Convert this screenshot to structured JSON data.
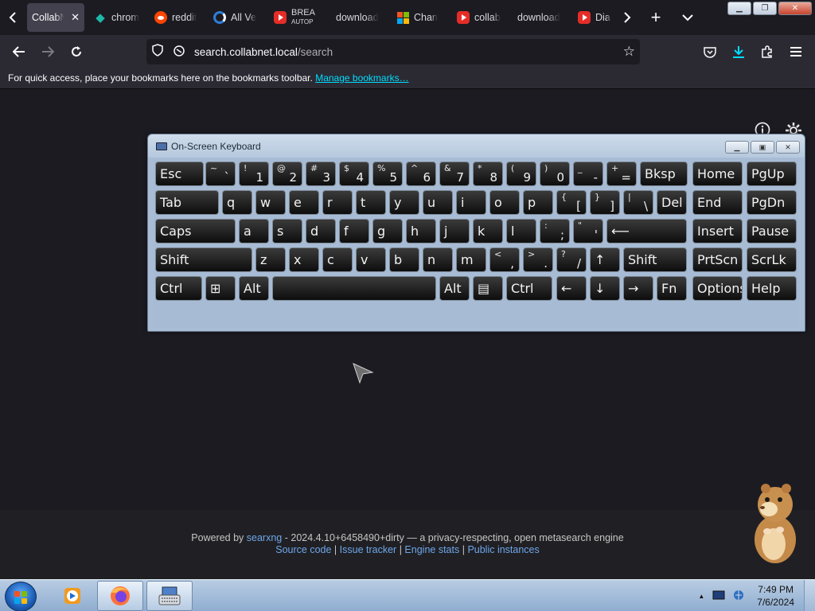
{
  "browser": {
    "tabs": [
      {
        "title": "CollabN",
        "icon": "",
        "active": true
      },
      {
        "title": "chrom",
        "icon": "chromatic-icon"
      },
      {
        "title": "reddit",
        "icon": "reddit-icon"
      },
      {
        "title": "All Ve",
        "icon": "edge-icon"
      },
      {
        "title": "BREA",
        "subtitle": "AUTOP",
        "icon": "youtube-icon"
      },
      {
        "title": "download",
        "icon": ""
      },
      {
        "title": "Chan",
        "icon": "microsoft-icon"
      },
      {
        "title": "collab",
        "icon": "youtube-icon"
      },
      {
        "title": "download",
        "icon": ""
      },
      {
        "title": "Diam",
        "icon": "youtube-icon"
      }
    ],
    "url_host": "search.collabnet.local",
    "url_path": "/search",
    "bookmarks_text": "For quick access, place your bookmarks here on the bookmarks toolbar.",
    "bookmarks_link": "Manage bookmarks…"
  },
  "footer": {
    "powered_by": "Powered by",
    "searxng": "searxng",
    "version_text": "- 2024.4.10+6458490+dirty — a privacy-respecting, open metasearch engine",
    "links": [
      "Source code",
      "Issue tracker",
      "Engine stats",
      "Public instances"
    ],
    "sep": "|"
  },
  "osk": {
    "title": "On-Screen Keyboard",
    "rows": [
      [
        {
          "m": "Esc"
        },
        {
          "s": "~",
          "l": "`"
        },
        {
          "s": "!",
          "l": "1"
        },
        {
          "s": "@",
          "l": "2"
        },
        {
          "s": "#",
          "l": "3"
        },
        {
          "s": "$",
          "l": "4"
        },
        {
          "s": "%",
          "l": "5"
        },
        {
          "s": "^",
          "l": "6"
        },
        {
          "s": "&",
          "l": "7"
        },
        {
          "s": "*",
          "l": "8"
        },
        {
          "s": "(",
          "l": "9"
        },
        {
          "s": ")",
          "l": "0"
        },
        {
          "s": "_",
          "l": "-"
        },
        {
          "s": "+",
          "l": "="
        },
        {
          "m": "Bksp"
        },
        {
          "m": "Home"
        },
        {
          "m": "PgUp"
        }
      ],
      [
        {
          "m": "Tab"
        },
        {
          "m": "q"
        },
        {
          "m": "w"
        },
        {
          "m": "e"
        },
        {
          "m": "r"
        },
        {
          "m": "t"
        },
        {
          "m": "y"
        },
        {
          "m": "u"
        },
        {
          "m": "i"
        },
        {
          "m": "o"
        },
        {
          "m": "p"
        },
        {
          "s": "{",
          "l": "["
        },
        {
          "s": "}",
          "l": "]"
        },
        {
          "s": "|",
          "l": "\\"
        },
        {
          "m": "Del"
        },
        {
          "m": "End"
        },
        {
          "m": "PgDn"
        }
      ],
      [
        {
          "m": "Caps"
        },
        {
          "m": "a"
        },
        {
          "m": "s"
        },
        {
          "m": "d"
        },
        {
          "m": "f"
        },
        {
          "m": "g"
        },
        {
          "m": "h"
        },
        {
          "m": "j"
        },
        {
          "m": "k"
        },
        {
          "m": "l"
        },
        {
          "s": ":",
          "l": ";"
        },
        {
          "s": "\"",
          "l": "'"
        },
        {
          "m": "⟵"
        },
        {
          "m": "Insert"
        },
        {
          "m": "Pause"
        }
      ],
      [
        {
          "m": "Shift"
        },
        {
          "m": "z"
        },
        {
          "m": "x"
        },
        {
          "m": "c"
        },
        {
          "m": "v"
        },
        {
          "m": "b"
        },
        {
          "m": "n"
        },
        {
          "m": "m"
        },
        {
          "s": "<",
          "l": ","
        },
        {
          "s": ">",
          "l": "."
        },
        {
          "s": "?",
          "l": "/"
        },
        {
          "m": "↑"
        },
        {
          "m": "Shift"
        },
        {
          "m": "PrtScn"
        },
        {
          "m": "ScrLk"
        }
      ],
      [
        {
          "m": "Ctrl"
        },
        {
          "m": "⊞"
        },
        {
          "m": "Alt"
        },
        {
          "m": ""
        },
        {
          "m": "Alt"
        },
        {
          "m": "▤"
        },
        {
          "m": "Ctrl"
        },
        {
          "m": "←"
        },
        {
          "m": "↓"
        },
        {
          "m": "→"
        },
        {
          "m": "Fn"
        },
        {
          "m": "Options"
        },
        {
          "m": "Help"
        }
      ]
    ]
  },
  "taskbar": {
    "time": "7:49 PM",
    "date": "7/6/2024",
    "tray_arrow": "▲"
  }
}
